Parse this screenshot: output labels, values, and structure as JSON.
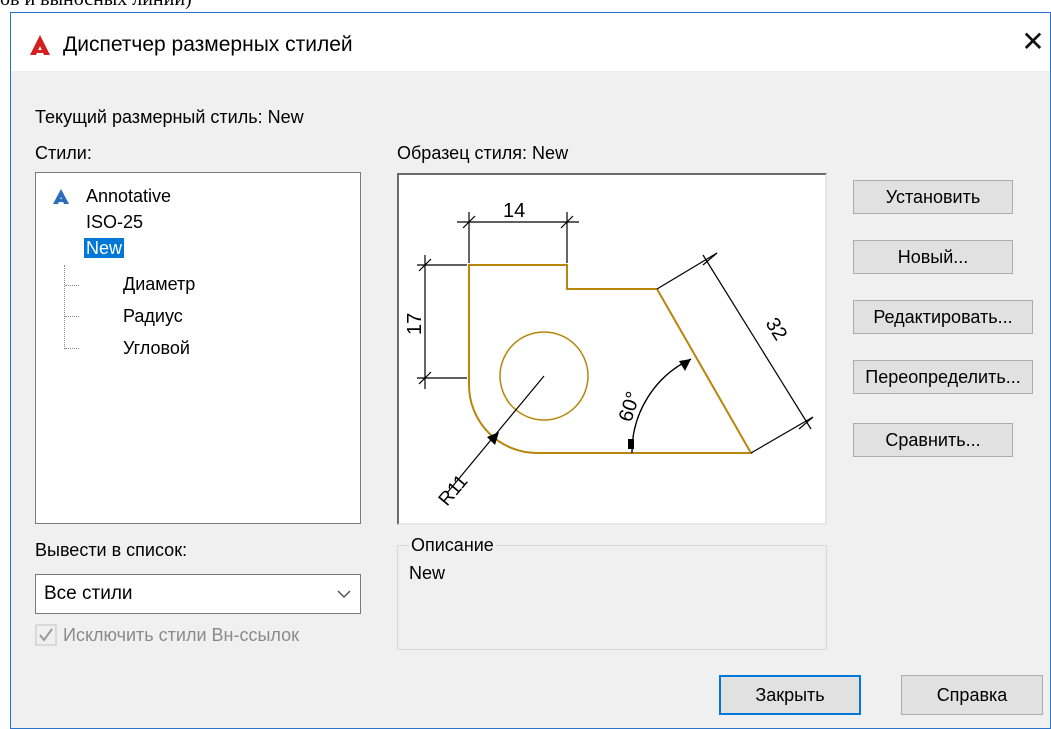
{
  "background_caption": "ов и выносных линий)",
  "window": {
    "title": "Диспетчер размерных стилей",
    "close_glyph": "✕"
  },
  "current_style": "Текущий размерный стиль: New",
  "styles_label": "Стили:",
  "styles": [
    {
      "label": "Annotative",
      "icon": "annotative-icon"
    },
    {
      "label": "ISO-25"
    },
    {
      "label": "New",
      "selected": true
    },
    {
      "label": "Диаметр",
      "child": true
    },
    {
      "label": "Радиус",
      "child": true
    },
    {
      "label": "Угловой",
      "child": true
    }
  ],
  "preview_label": "Образец стиля: New",
  "preview_dims": {
    "top": "14",
    "left": "17",
    "slant": "32",
    "angle": "60°",
    "radius": "R11"
  },
  "buttons": {
    "set": "Установить",
    "new": "Новый...",
    "edit": "Редактировать...",
    "override": "Переопределить...",
    "compare": "Сравнить...",
    "close": "Закрыть",
    "help": "Справка"
  },
  "list_label": "Вывести в список:",
  "list_value": "Все стили",
  "exclude_xref_label": "Исключить стили Вн-ссылок",
  "description": {
    "label": "Описание",
    "text": "New"
  },
  "colors": {
    "accent": "#0078d7",
    "geometry": "#b8860b",
    "dim_line": "#000000"
  }
}
